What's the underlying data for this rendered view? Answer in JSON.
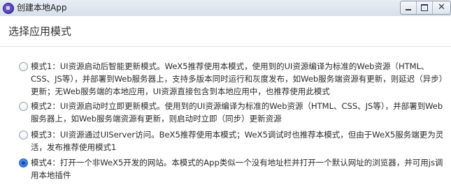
{
  "window": {
    "title": "创建本地App",
    "controls": {
      "minimize": "minimize",
      "maximize": "maximize",
      "close": "✕"
    }
  },
  "header": {
    "title": "选择应用模式"
  },
  "options": [
    {
      "checked": false,
      "text": "模式1：UI资源启动后智能更新模式。WeX5推荐使用本模式，使用到的UI资源编译为标准的Web资源（HTML、CSS、JS等），并部署到Web服务器上，支持多版本同时运行和灰度发布，如Web服务端资源有更新，则延迟（异步）更新；无Web服务端的本地应用，UI资源直接包含到本地应用中，也推荐使用此模式"
    },
    {
      "checked": false,
      "text": "模式2：UI资源启动时立即更新模式。使用到的UI资源编译为标准的Web资源（HTML、CSS、JS等），并部署到Web服务器上，如Web服务端资源有更新，则启动时立即（同步）更新资源"
    },
    {
      "checked": false,
      "text": "模式3：UI资源通过UIServer访问。BeX5推荐使用本模式；WeX5调试时也推荐本模式，但由于WeX5服务端更为灵活，发布推荐使用模式1"
    },
    {
      "checked": true,
      "text": "模式4：打开一个非WeX5开发的网站。本模式的App类似一个没有地址栏并打开一个默认网址的浏览器，并可用js调用本地插件"
    }
  ]
}
